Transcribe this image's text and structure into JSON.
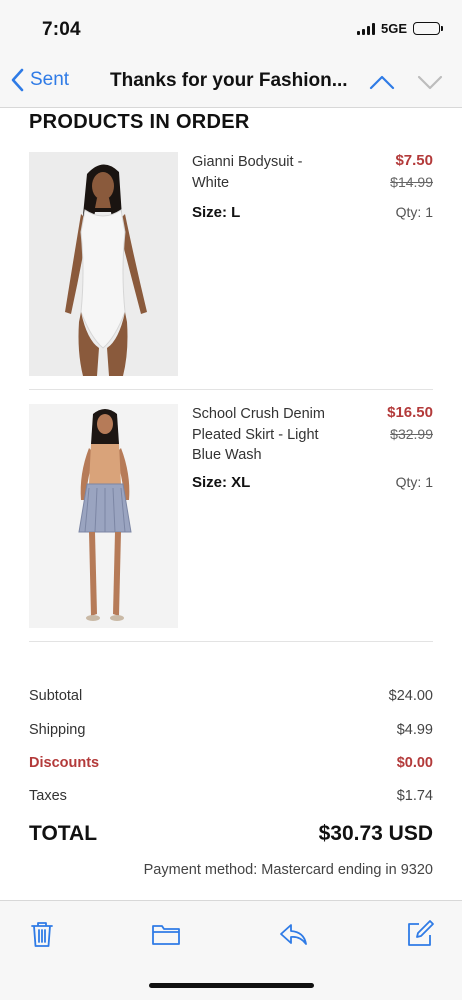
{
  "status_bar": {
    "time": "7:04",
    "network": "5GE"
  },
  "nav": {
    "back_label": "Sent",
    "title": "Thanks for your Fashion..."
  },
  "section_title": "PRODUCTS IN ORDER",
  "products": [
    {
      "name": "Gianni Bodysuit - White",
      "price": "$7.50",
      "original_price": "$14.99",
      "size_label": "Size: L",
      "qty_label": "Qty: 1"
    },
    {
      "name": "School Crush Denim Pleated Skirt - Light Blue Wash",
      "price": "$16.50",
      "original_price": "$32.99",
      "size_label": "Size: XL",
      "qty_label": "Qty: 1"
    }
  ],
  "summary": {
    "subtotal": {
      "label": "Subtotal",
      "value": "$24.00"
    },
    "shipping": {
      "label": "Shipping",
      "value": "$4.99"
    },
    "discounts": {
      "label": "Discounts",
      "value": "$0.00"
    },
    "taxes": {
      "label": "Taxes",
      "value": "$1.74"
    },
    "total": {
      "label": "TOTAL",
      "value": "$30.73 USD"
    },
    "payment_method": "Payment method: Mastercard ending in 9320"
  },
  "toolbar": {
    "icons": [
      "trash-icon",
      "folder-icon",
      "reply-icon",
      "compose-icon"
    ]
  },
  "colors": {
    "accent_blue": "#2f7be6",
    "sale_red": "#b33a3a"
  }
}
